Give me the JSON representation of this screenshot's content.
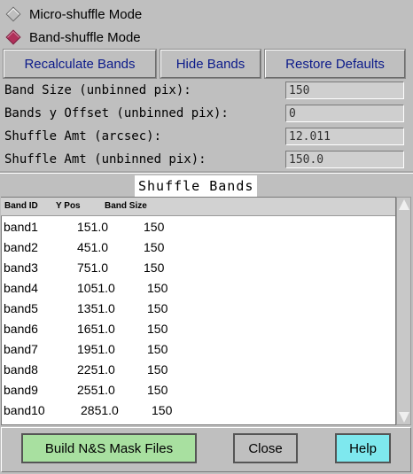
{
  "mode": {
    "options": [
      {
        "label": "Micro-shuffle Mode",
        "selected": false
      },
      {
        "label": "Band-shuffle Mode",
        "selected": true
      }
    ]
  },
  "toolbar": {
    "recalculate_label": "Recalculate Bands",
    "hide_label": "Hide Bands",
    "restore_label": "Restore Defaults"
  },
  "form": {
    "band_size_label": "Band Size (unbinned pix):",
    "band_size_value": "150",
    "offset_label": "Bands y Offset (unbinned pix):",
    "offset_value": "0",
    "shuffle_arcsec_label": "Shuffle Amt (arcsec):",
    "shuffle_arcsec_value": "12.011",
    "shuffle_pix_label": "Shuffle Amt (unbinned pix):",
    "shuffle_pix_value": "150.0"
  },
  "section_title": "Shuffle Bands",
  "table": {
    "columns": [
      "Band ID",
      "Y Pos",
      "Band Size"
    ],
    "rows": [
      {
        "id": "band1",
        "ypos": "151.0",
        "size": "150"
      },
      {
        "id": "band2",
        "ypos": "451.0",
        "size": "150"
      },
      {
        "id": "band3",
        "ypos": "751.0",
        "size": "150"
      },
      {
        "id": "band4",
        "ypos": "1051.0",
        "size": "150"
      },
      {
        "id": "band5",
        "ypos": "1351.0",
        "size": "150"
      },
      {
        "id": "band6",
        "ypos": "1651.0",
        "size": "150"
      },
      {
        "id": "band7",
        "ypos": "1951.0",
        "size": "150"
      },
      {
        "id": "band8",
        "ypos": "2251.0",
        "size": "150"
      },
      {
        "id": "band9",
        "ypos": "2551.0",
        "size": "150"
      },
      {
        "id": "band10",
        "ypos": "2851.0",
        "size": "150"
      }
    ]
  },
  "footer": {
    "build_label": "Build N&S Mask Files",
    "close_label": "Close",
    "help_label": "Help"
  },
  "colors": {
    "build_bg": "#a8e0a0",
    "help_bg": "#7ee8ee",
    "accent_text": "#0b1a8a",
    "radio_selected": "#b0305a"
  }
}
